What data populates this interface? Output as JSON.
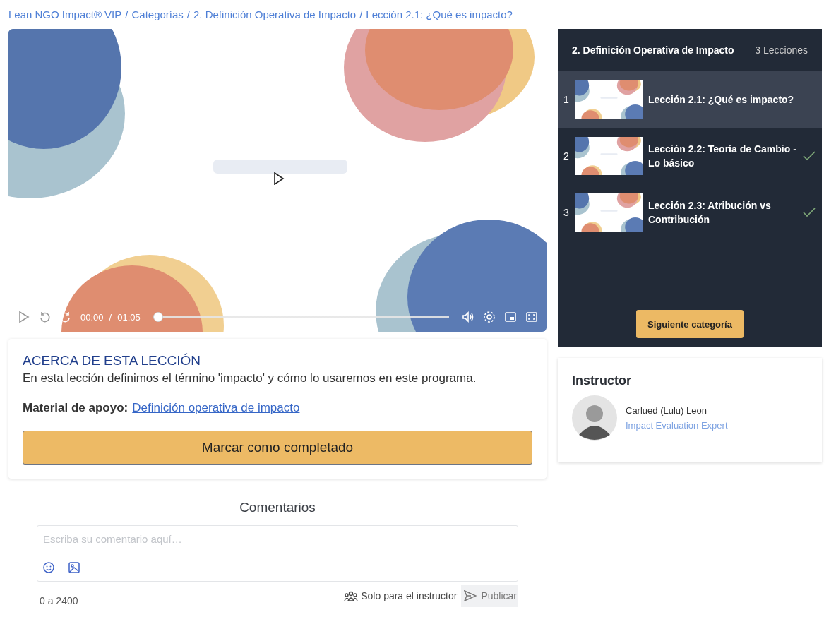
{
  "breadcrumb": {
    "separator": "/",
    "items": [
      "Lean NGO Impact® VIP",
      "Categorías",
      "2. Definición Operativa de Impacto",
      "Lección 2.1: ¿Qué es impacto?"
    ]
  },
  "video": {
    "kind": "picture",
    "current_time": "00:00",
    "time_separator": "/",
    "duration": "01:05",
    "level": 0
  },
  "chapter": {
    "title": "2. Definición Operativa de Impacto",
    "count": "3 Lecciones",
    "lessons": [
      {
        "number": "1",
        "title": "Lección 2.1: ¿Qué es impacto?",
        "selected": true,
        "completed": false
      },
      {
        "number": "2",
        "title": "Lección 2.2: Teoría de Cambio - Lo básico",
        "selected": false,
        "completed": true
      },
      {
        "number": "3",
        "title": "Lección 2.3: Atribución vs Contribución",
        "selected": false,
        "completed": true
      }
    ],
    "next_button": "Siguiente categoría"
  },
  "about": {
    "heading": "ACERCA DE ESTA LECCIÓN",
    "description": "En esta lección definimos el término 'impacto' y cómo lo usaremos en este programa.",
    "material_label": "Material de apoyo:",
    "material_link": "Definición operativa de impacto",
    "complete_button": "Marcar como completado"
  },
  "instructor": {
    "heading": "Instructor",
    "name": "Carlued (Lulu) Leon",
    "role": "Impact Evaluation Expert"
  },
  "comments": {
    "title": "Comentarios",
    "placeholder": "Escriba su comentario aquí…",
    "counter": "0 a 2400",
    "visibility": "Solo para el instructor",
    "publish_button": "Publicar"
  }
}
